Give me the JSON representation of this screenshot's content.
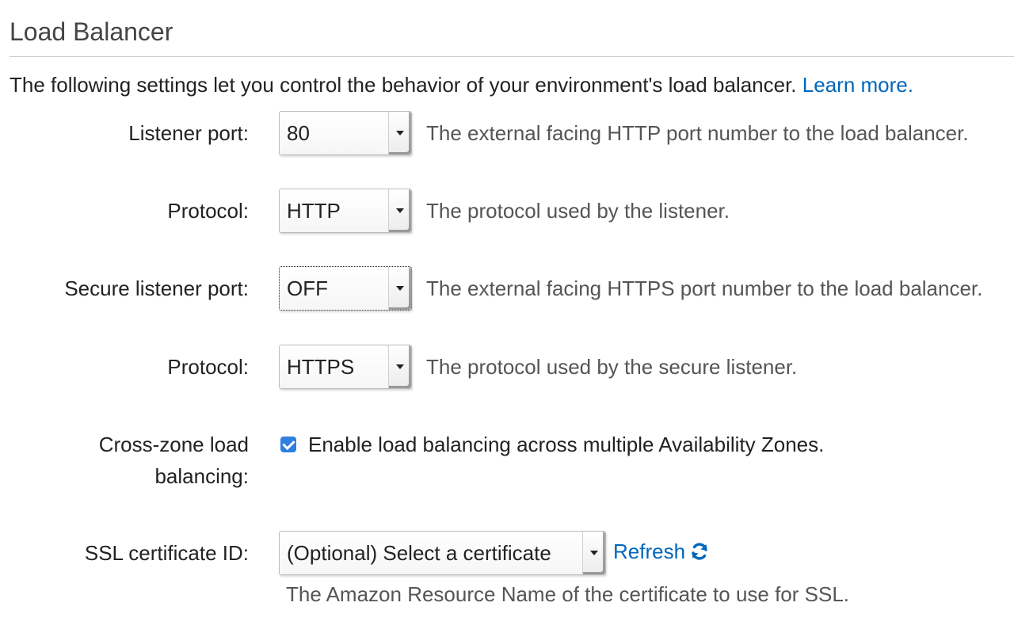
{
  "section": {
    "title": "Load Balancer",
    "intro": "The following settings let you control the behavior of your environment's load balancer.",
    "learn_more": "Learn more."
  },
  "fields": {
    "listener_port": {
      "label": "Listener port:",
      "value": "80",
      "help": "The external facing HTTP port number to the load balancer."
    },
    "protocol": {
      "label": "Protocol:",
      "value": "HTTP",
      "help": "The protocol used by the listener."
    },
    "secure_listener_port": {
      "label": "Secure listener port:",
      "value": "OFF",
      "help": "The external facing HTTPS port number to the load balancer."
    },
    "secure_protocol": {
      "label": "Protocol:",
      "value": "HTTPS",
      "help": "The protocol used by the secure listener."
    },
    "cross_zone": {
      "label": "Cross-zone load balancing:",
      "checked": true,
      "checkbox_label": "Enable load balancing across multiple Availability Zones."
    },
    "ssl_certificate": {
      "label": "SSL certificate ID:",
      "placeholder": "(Optional) Select a certificate",
      "refresh_label": "Refresh",
      "refresh_icon": "refresh-icon",
      "help": "The Amazon Resource Name of the certificate to use for SSL."
    }
  },
  "colors": {
    "link": "#0066bb",
    "checkbox": "#2f7fe0",
    "help_text": "#555555"
  }
}
